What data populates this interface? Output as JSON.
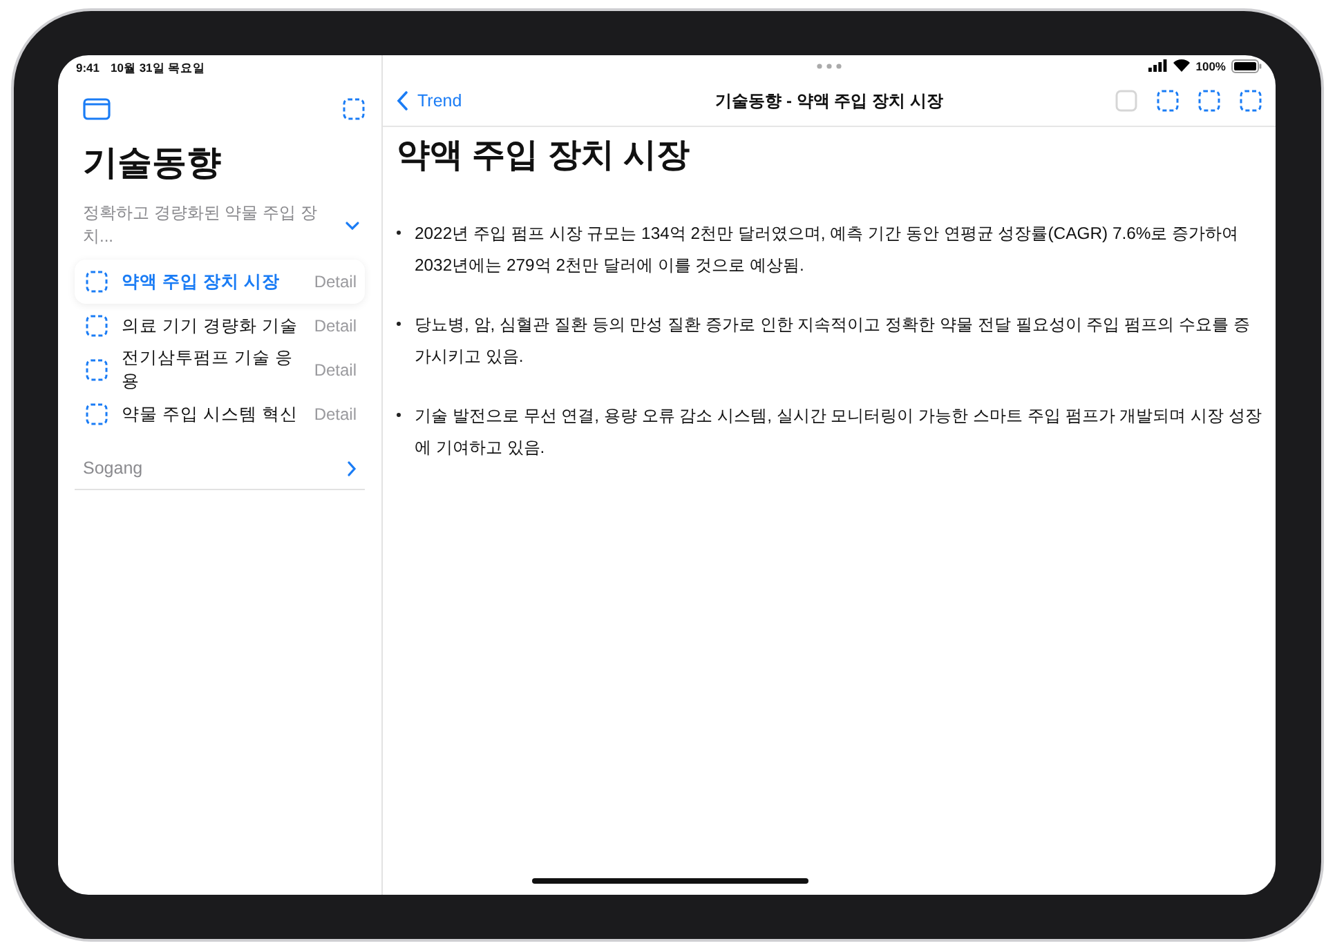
{
  "status_bar": {
    "time": "9:41",
    "date": "10월 31일 목요일",
    "battery": "100%"
  },
  "sidebar": {
    "title": "기술동향",
    "subtitle": "정확하고 경량화된 약물 주입 장치...",
    "items": [
      {
        "label": "약액 주입 장치 시장",
        "detail": "Detail",
        "selected": true
      },
      {
        "label": "의료 기기 경량화 기술",
        "detail": "Detail",
        "selected": false
      },
      {
        "label": "전기삼투펌프 기술 응용",
        "detail": "Detail",
        "selected": false
      },
      {
        "label": "약물 주입 시스템 혁신",
        "detail": "Detail",
        "selected": false
      }
    ],
    "section": "Sogang"
  },
  "nav": {
    "back": "Trend",
    "title": "기술동향 - 약액 주입 장치 시장",
    "toolbar": [
      {
        "disabled": true
      },
      {
        "disabled": false
      },
      {
        "disabled": false
      },
      {
        "disabled": false
      }
    ]
  },
  "detail": {
    "heading": "약액 주입 장치 시장",
    "bullets": [
      "2022년 주입 펌프 시장 규모는 134억 2천만 달러였으며, 예측 기간 동안 연평균 성장률(CAGR) 7.6%로 증가하여 2032년에는 279억 2천만 달러에 이를 것으로 예상됨.",
      "당뇨병, 암, 심혈관 질환 등의 만성 질환 증가로 인한 지속적이고 정확한 약물 전달 필요성이 주입 펌프의 수요를 증가시키고 있음.",
      "기술 발전으로 무선 연결, 용량 오류 감소 시스템, 실시간 모니터링이 가능한 스마트 주입 펌프가 개발되며 시장 성장에 기여하고 있음."
    ]
  }
}
